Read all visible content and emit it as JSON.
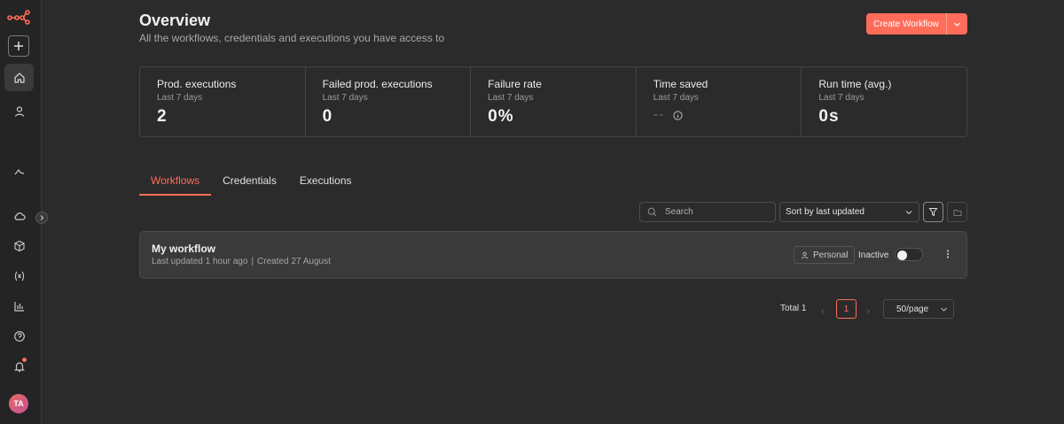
{
  "sidebar": {
    "logo_icon": "n8n-logo-icon",
    "items": [
      {
        "name": "add",
        "icon": "plus-icon"
      },
      {
        "name": "overview",
        "icon": "home-icon",
        "active": true
      },
      {
        "name": "personal",
        "icon": "user-icon"
      },
      {
        "name": "templates",
        "icon": "chart-line-icon"
      },
      {
        "name": "admin",
        "icon": "cloud-icon"
      },
      {
        "name": "cube",
        "icon": "cube-icon"
      },
      {
        "name": "variables",
        "icon": "variable-icon"
      },
      {
        "name": "insights",
        "icon": "bar-chart-icon"
      },
      {
        "name": "help",
        "icon": "help-icon"
      },
      {
        "name": "notifications",
        "icon": "bell-icon"
      }
    ],
    "avatar_initials": "TA"
  },
  "header": {
    "title": "Overview",
    "subtitle": "All the workflows, credentials and executions you have access to",
    "create_button": "Create Workflow"
  },
  "stats": [
    {
      "label": "Prod. executions",
      "period": "Last 7 days",
      "value": "2"
    },
    {
      "label": "Failed prod. executions",
      "period": "Last 7 days",
      "value": "0"
    },
    {
      "label": "Failure rate",
      "period": "Last 7 days",
      "value": "0%"
    },
    {
      "label": "Time saved",
      "period": "Last 7 days",
      "value": "--"
    },
    {
      "label": "Run time (avg.)",
      "period": "Last 7 days",
      "value": "0s"
    }
  ],
  "tabs": [
    {
      "label": "Workflows",
      "active": true
    },
    {
      "label": "Credentials"
    },
    {
      "label": "Executions"
    }
  ],
  "toolbar": {
    "search_placeholder": "Search",
    "sort_value": "Sort by last updated"
  },
  "workflows": [
    {
      "name": "My workflow",
      "updated": "Last updated 1 hour ago",
      "created": "Created 27 August",
      "owner_badge": "Personal",
      "status": "Inactive",
      "active": false
    }
  ],
  "pagination": {
    "total": "Total 1",
    "current_page": "1",
    "per_page": "50/page"
  },
  "colors": {
    "accent": "#ff6d5a",
    "background": "#2b2b2b",
    "sidebar": "#242424",
    "card": "#3a3a3a"
  }
}
